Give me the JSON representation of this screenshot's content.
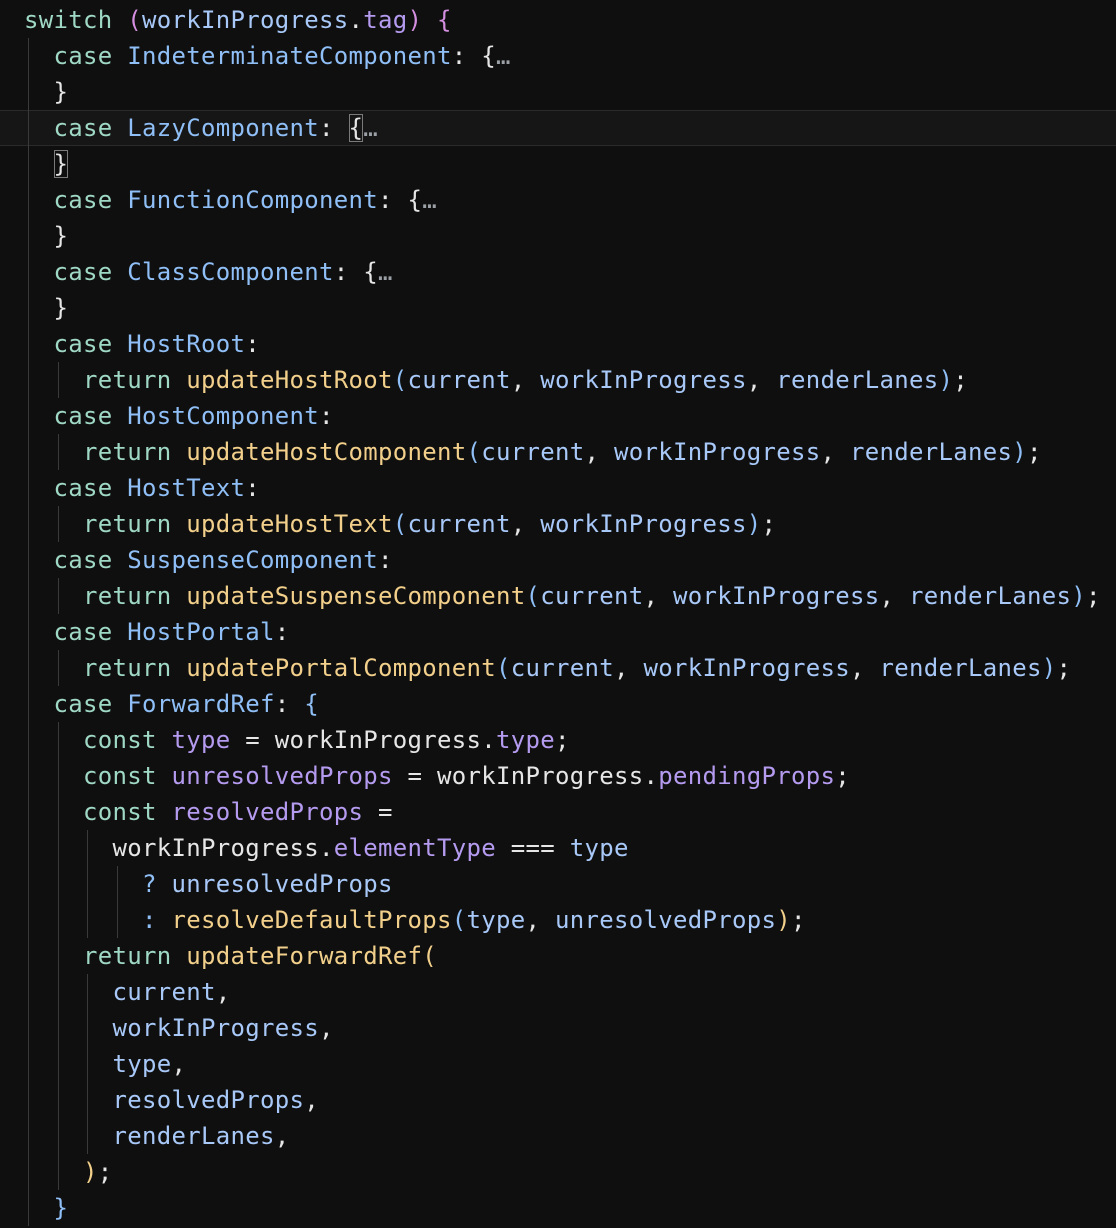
{
  "editor": {
    "lines": [
      "switch (workInProgress.tag) {",
      "  case IndeterminateComponent: {…",
      "  }",
      "  case LazyComponent: {…",
      "  }",
      "  case FunctionComponent: {…",
      "  }",
      "  case ClassComponent: {…",
      "  }",
      "  case HostRoot:",
      "    return updateHostRoot(current, workInProgress, renderLanes);",
      "  case HostComponent:",
      "    return updateHostComponent(current, workInProgress, renderLanes);",
      "  case HostText:",
      "    return updateHostText(current, workInProgress);",
      "  case SuspenseComponent:",
      "    return updateSuspenseComponent(current, workInProgress, renderLanes);",
      "  case HostPortal:",
      "    return updatePortalComponent(current, workInProgress, renderLanes);",
      "  case ForwardRef: {",
      "    const type = workInProgress.type;",
      "    const unresolvedProps = workInProgress.pendingProps;",
      "    const resolvedProps =",
      "      workInProgress.elementType === type",
      "        ? unresolvedProps",
      "        : resolveDefaultProps(type, unresolvedProps);",
      "    return updateForwardRef(",
      "      current,",
      "      workInProgress,",
      "      type,",
      "      resolvedProps,",
      "      renderLanes,",
      "    );",
      "  }"
    ],
    "current_line": 4,
    "colors": {
      "background": "#0f0f0f",
      "keyword": "#9fd8c5",
      "type": "#8fbff6",
      "function": "#f2d08b",
      "variable": "#a8c8f8",
      "property": "#b59bf0"
    }
  }
}
